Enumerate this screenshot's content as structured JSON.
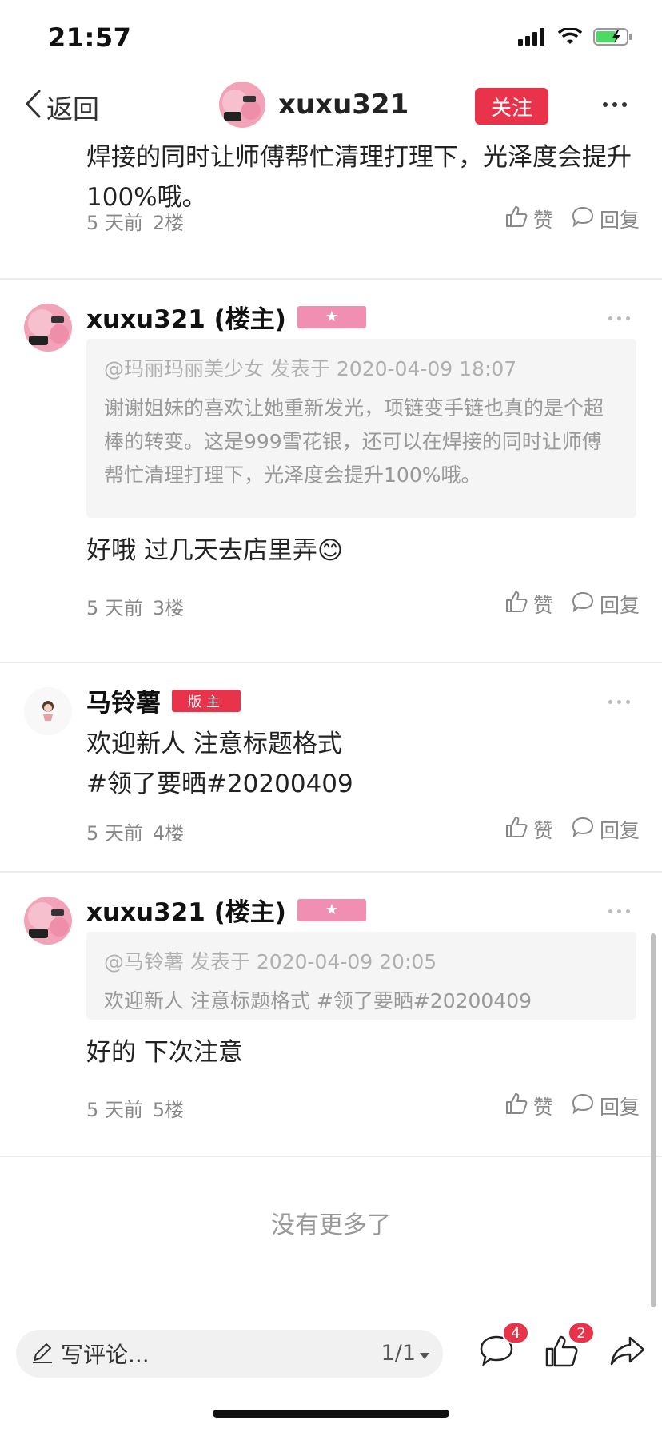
{
  "status_bar": {
    "time": "21:57"
  },
  "nav": {
    "back_label": "返回",
    "username": "xuxu321",
    "follow_label": "关注"
  },
  "top_post": {
    "text": "焊接的同时让师傅帮忙清理打理下，光泽度会提升100%哦。",
    "time_ago": "5 天前",
    "floor": "2楼"
  },
  "actions": {
    "like_label": "赞",
    "reply_label": "回复"
  },
  "floors": [
    {
      "name": "xuxu321 (楼主)",
      "badge": "★",
      "quote_head": "@玛丽玛丽美少女 发表于 2020-04-09 18:07",
      "quote_body": "谢谢姐妹的喜欢让她重新发光，项链变手链也真的是个超棒的转变。这是999雪花银，还可以在焊接的同时让师傅帮忙清理打理下，光泽度会提升100%哦。",
      "text": "好哦  过几天去店里弄😊",
      "time_ago": "5 天前",
      "floor": "3楼"
    },
    {
      "name": "马铃薯",
      "badge": "版主",
      "text_line1": "欢迎新人 注意标题格式",
      "text_line2": "#领了要晒#20200409",
      "time_ago": "5 天前",
      "floor": "4楼"
    },
    {
      "name": "xuxu321 (楼主)",
      "badge": "★",
      "quote_head": "@马铃薯 发表于 2020-04-09 20:05",
      "quote_body": "欢迎新人 注意标题格式 #领了要晒#20200409",
      "text": "好的  下次注意",
      "time_ago": "5 天前",
      "floor": "5楼"
    }
  ],
  "no_more": "没有更多了",
  "bottom_bar": {
    "comment_placeholder": "写评论...",
    "page_indicator": "1/1",
    "comment_count": "4",
    "like_count": "2"
  },
  "colors": {
    "accent_red": "#e8334a",
    "owner_badge_pink": "#f08fb2",
    "quote_bg": "#f5f5f5"
  },
  "icons": [
    "signal-icon",
    "wifi-icon",
    "battery-icon",
    "back-chevron-icon",
    "more-icon",
    "thumb-up-icon",
    "reply-bubble-icon",
    "pencil-icon",
    "caret-down-icon",
    "comment-icon",
    "like-icon",
    "share-icon"
  ]
}
